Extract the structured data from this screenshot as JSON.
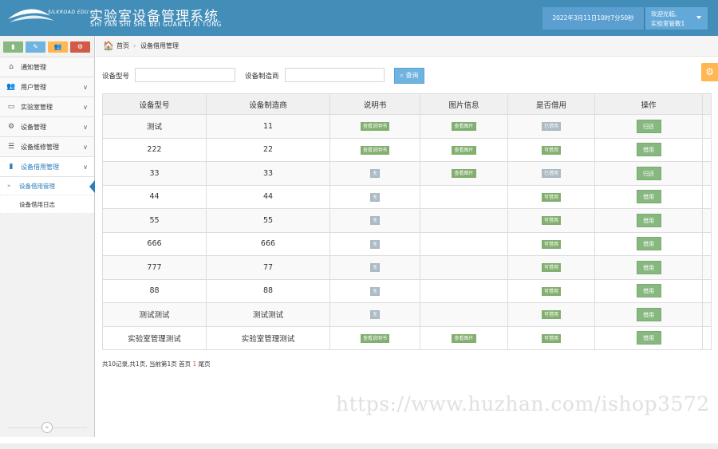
{
  "header": {
    "logo_text": "SILKROAD EDU",
    "title": "实验室设备管理系统",
    "subtitle": "SHI YAN SHI SHE BEI GUAN LI XI TONG",
    "datetime": "2022年3月11日10时7分50秒",
    "welcome": "欢迎光临,",
    "user_name": "实验室管教1"
  },
  "colors": {
    "header": "#438eb9",
    "green": "#82af6f",
    "gray": "#abbac3",
    "blue": "#6fb3e0",
    "orange": "#ffb752"
  },
  "shortcuts": [
    {
      "icon": "signal-icon",
      "color": "#87b87f",
      "glyph": "▮"
    },
    {
      "icon": "pencil-icon",
      "color": "#6fb3e0",
      "glyph": "✎"
    },
    {
      "icon": "group-icon",
      "color": "#ffb752",
      "glyph": "👥"
    },
    {
      "icon": "cogs-icon",
      "color": "#d15b47",
      "glyph": "⚙"
    }
  ],
  "sidebar": {
    "items": [
      {
        "label": "通知管理",
        "icon": "home-icon",
        "glyph": "⌂"
      },
      {
        "label": "用户管理",
        "icon": "users-icon",
        "glyph": "👥"
      },
      {
        "label": "实验室管理",
        "icon": "desktop-icon",
        "glyph": "▭"
      },
      {
        "label": "设备管理",
        "icon": "cogs-icon",
        "glyph": "⚙"
      },
      {
        "label": "设备维修管理",
        "icon": "list-icon",
        "glyph": "☰"
      },
      {
        "label": "设备借用管理",
        "icon": "bookmark-icon",
        "glyph": "▮"
      }
    ],
    "sub_items": [
      {
        "label": "设备借用管理"
      },
      {
        "label": "设备借用日志"
      }
    ]
  },
  "breadcrumb": {
    "home": "首页",
    "current": "设备借用管理"
  },
  "search": {
    "model_label": "设备型号",
    "model_value": "",
    "maker_label": "设备制造商",
    "maker_value": "",
    "button": "查询"
  },
  "table": {
    "columns": [
      "设备型号",
      "设备制造商",
      "说明书",
      "图片信息",
      "是否借用",
      "操作"
    ],
    "rows": [
      {
        "model": "测试",
        "maker": "11",
        "manual": "查看说明书",
        "image": "查看图片",
        "status": "已借用",
        "action": "归还"
      },
      {
        "model": "222",
        "maker": "22",
        "manual": "查看说明书",
        "image": "查看图片",
        "status": "可借用",
        "action": "借用"
      },
      {
        "model": "33",
        "maker": "33",
        "manual": "无",
        "image": "查看图片",
        "status": "已借用",
        "action": "归还"
      },
      {
        "model": "44",
        "maker": "44",
        "manual": "无",
        "image": "",
        "status": "可借用",
        "action": "借用"
      },
      {
        "model": "55",
        "maker": "55",
        "manual": "无",
        "image": "",
        "status": "可借用",
        "action": "借用"
      },
      {
        "model": "666",
        "maker": "666",
        "manual": "无",
        "image": "",
        "status": "可借用",
        "action": "借用"
      },
      {
        "model": "777",
        "maker": "77",
        "manual": "无",
        "image": "",
        "status": "可借用",
        "action": "借用"
      },
      {
        "model": "88",
        "maker": "88",
        "manual": "无",
        "image": "",
        "status": "可借用",
        "action": "借用"
      },
      {
        "model": "测试测试",
        "maker": "测试测试",
        "manual": "无",
        "image": "",
        "status": "可借用",
        "action": "借用"
      },
      {
        "model": "实验室管理测试",
        "maker": "实验室管理测试",
        "manual": "查看说明书",
        "image": "查看图片",
        "status": "可借用",
        "action": "借用"
      }
    ]
  },
  "pager": {
    "prefix": "共10记录,共1页, 当前第1页 首页 ",
    "current": "1",
    "suffix": " 尾页"
  },
  "watermark": "https://www.huzhan.com/ishop3572"
}
